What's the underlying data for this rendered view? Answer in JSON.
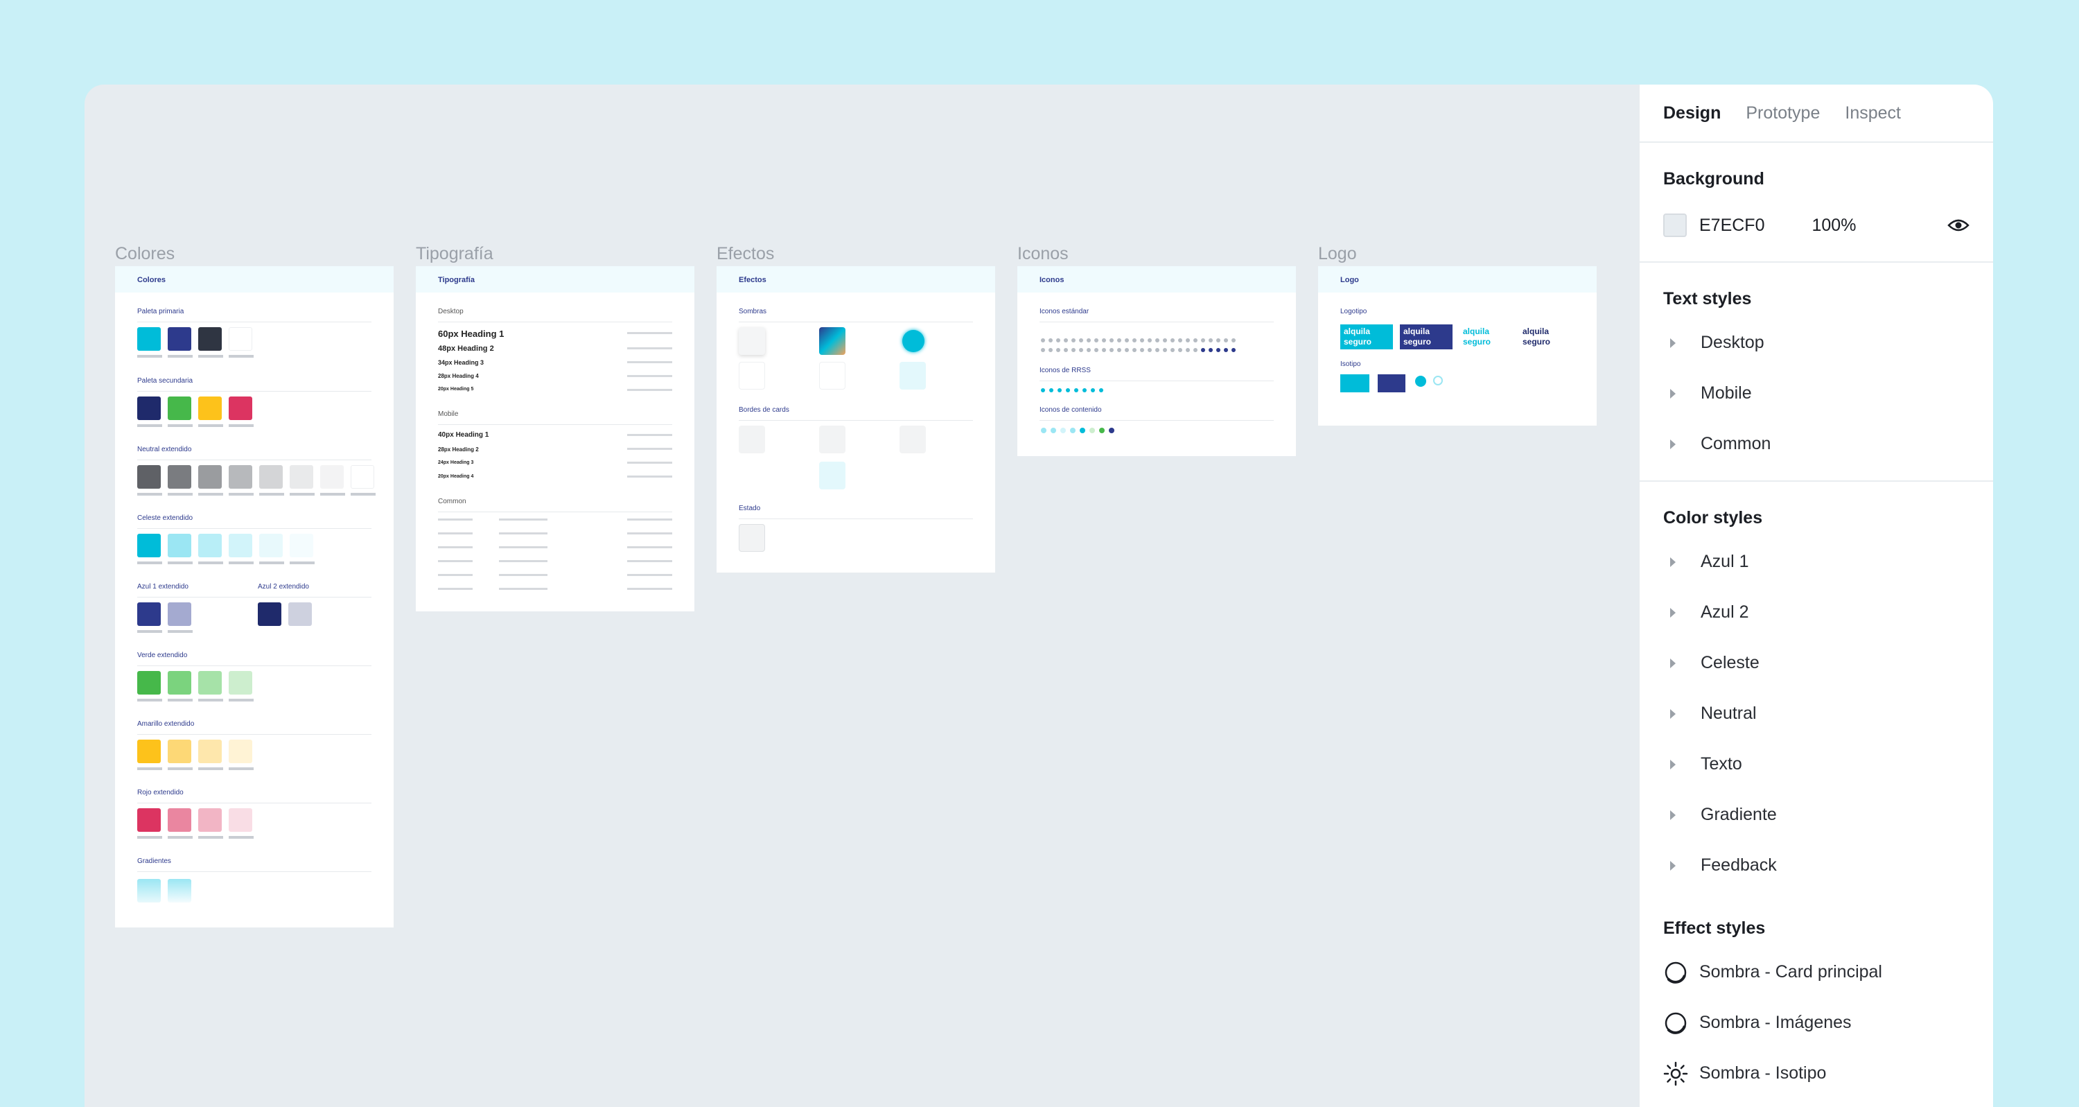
{
  "panel": {
    "tabs": [
      "Design",
      "Prototype",
      "Inspect"
    ],
    "background": {
      "heading": "Background",
      "hex": "E7ECF0",
      "opacity": "100%",
      "color": "#E7ECF0"
    },
    "text_styles": {
      "heading": "Text styles",
      "items": [
        "Desktop",
        "Mobile",
        "Common"
      ]
    },
    "color_styles": {
      "heading": "Color styles",
      "items": [
        "Azul 1",
        "Azul 2",
        "Celeste",
        "Neutral",
        "Texto",
        "Gradiente",
        "Feedback"
      ]
    },
    "effect_styles": {
      "heading": "Effect styles",
      "items": [
        "Sombra - Card principal",
        "Sombra - Imágenes",
        "Sombra - Isotipo"
      ]
    }
  },
  "frames": {
    "colores": {
      "title": "Colores",
      "header": "Colores",
      "sections": [
        "Paleta primaria",
        "Paleta secundaria",
        "Neutral extendido",
        "Celeste extendido",
        "Azul 1 extendido",
        "Azul 2 extendido",
        "Verde extendido",
        "Amarillo extendido",
        "Rojo extendido",
        "Gradientes"
      ]
    },
    "tipografia": {
      "title": "Tipografía",
      "header": "Tipografía",
      "desktop_label": "Desktop",
      "mobile_label": "Mobile",
      "common_label": "Common",
      "desktop": [
        "60px Heading 1",
        "48px Heading 2",
        "34px Heading 3",
        "28px Heading 4",
        "20px Heading 5"
      ],
      "mobile": [
        "40px Heading 1",
        "28px Heading 2",
        "24px Heading 3",
        "20px Heading 4"
      ]
    },
    "efectos": {
      "title": "Efectos",
      "header": "Efectos",
      "sections": [
        "Sombras",
        "Bordes de cards",
        "Estado"
      ]
    },
    "iconos": {
      "title": "Iconos",
      "header": "Iconos",
      "sections": [
        "Iconos estándar",
        "Iconos de RRSS",
        "Iconos de contenido"
      ]
    },
    "logo": {
      "title": "Logo",
      "header": "Logo",
      "sections": [
        "Logotipo",
        "Isotipo"
      ],
      "logo_text": "alquila seguro"
    }
  },
  "colors": {
    "primaria": [
      "#00BCD9",
      "#2D3A8C",
      "#2F3542",
      "#FFFFFF"
    ],
    "secundaria": [
      "#1F2A6B",
      "#46B84A",
      "#FDC21B",
      "#DC3461"
    ],
    "neutral": [
      "#5F6166",
      "#7A7C80",
      "#9A9C9F",
      "#B7B9BC",
      "#D4D5D7",
      "#E9EAEB",
      "#F3F3F4",
      "#FFFFFF"
    ],
    "celeste": [
      "#00BCD9",
      "#9BE6F3",
      "#B8EEF7",
      "#D2F4FA",
      "#E8F9FC",
      "#F4FCFE"
    ],
    "azul1": [
      "#2D3A8C",
      "#A4AAD0"
    ],
    "azul2": [
      "#1F2A6B",
      "#CED1DF"
    ],
    "verde": [
      "#46B84A",
      "#7BD37E",
      "#A6E2A8",
      "#CDEECE"
    ],
    "amarillo": [
      "#FDC21B",
      "#FDD876",
      "#FEE7AC",
      "#FFF3D5"
    ],
    "rojo": [
      "#DC3461",
      "#EA86A0",
      "#F2B5C5",
      "#F9DDE5"
    ]
  }
}
